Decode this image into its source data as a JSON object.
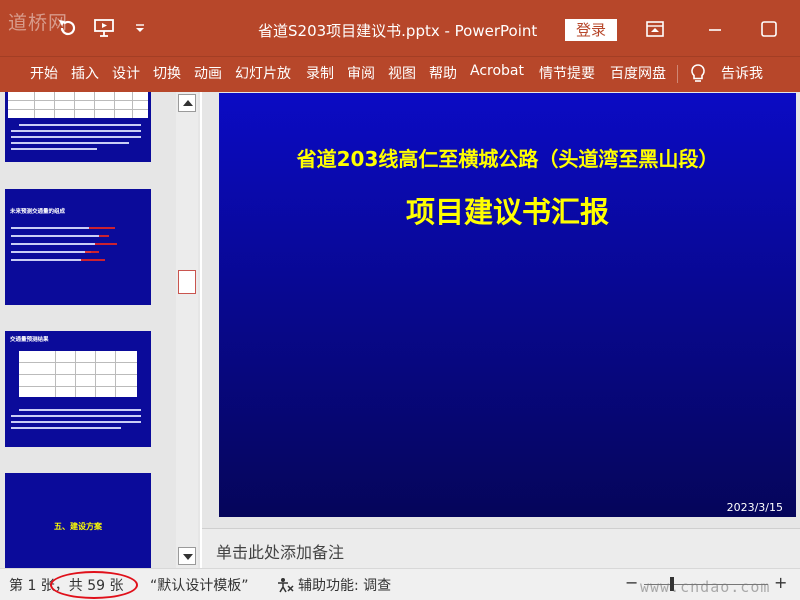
{
  "titlebar": {
    "watermark_logo": "道桥网",
    "document_title": "省道S203项目建议书.pptx  -  PowerPoint",
    "login_label": "登录",
    "icons": [
      "undo-icon",
      "slideshow-from-start-icon",
      "customize-qat-icon",
      "ribbon-display-options-icon",
      "maximize-icon"
    ]
  },
  "ribbon": {
    "tabs": [
      "开始",
      "插入",
      "设计",
      "切换",
      "动画",
      "幻灯片放",
      "录制",
      "审阅",
      "视图",
      "帮助",
      "Acrobat",
      "情节提要",
      "百度网盘"
    ],
    "tell_me": "告诉我"
  },
  "thumbnails": [
    {
      "kind": "table-and-text"
    },
    {
      "kind": "bullets",
      "title": "未来预测交通量的组成"
    },
    {
      "kind": "table-and-text",
      "title": "交通量预测结果"
    },
    {
      "kind": "section",
      "title": "五、建设方案"
    }
  ],
  "slide": {
    "subtitle": "省道203线高仁至横城公路（头道湾至黑山段）",
    "title": "项目建议书汇报",
    "date": "2023/3/15"
  },
  "notes": {
    "placeholder": "单击此处添加备注"
  },
  "statusbar": {
    "slide_position": "第 1 张，共 59 张",
    "theme": "“默认设计模板”",
    "accessibility": "辅助功能: 调查"
  },
  "bottom_watermark": "www.cndao.com",
  "colors": {
    "accent": "#b7472a",
    "slide_bg": "#0b0bc4",
    "slide_text": "#ffff00",
    "highlight_ellipse": "#e0101a"
  }
}
